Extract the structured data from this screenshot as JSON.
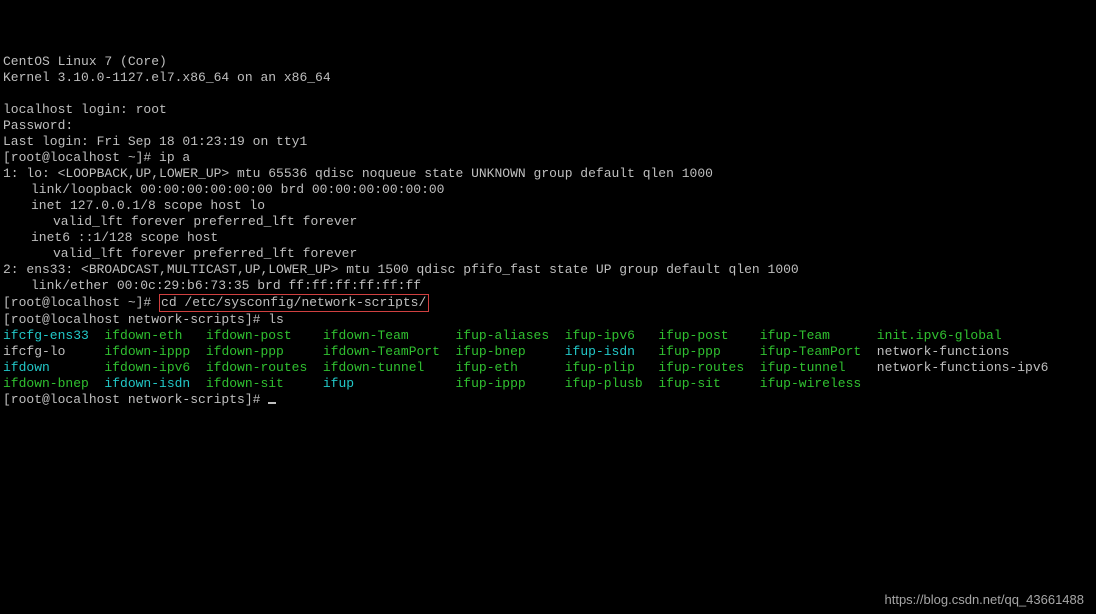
{
  "banner": {
    "l1": "CentOS Linux 7 (Core)",
    "l2": "Kernel 3.10.0-1127.el7.x86_64 on an x86_64"
  },
  "login": {
    "prompt": "localhost login: root",
    "password": "Password:",
    "last": "Last login: Fri Sep 18 01:23:19 on tty1"
  },
  "prompt1": {
    "full": "[root@localhost ~]# ip a"
  },
  "ip": {
    "lo1": "1: lo: <LOOPBACK,UP,LOWER_UP> mtu 65536 qdisc noqueue state UNKNOWN group default qlen 1000",
    "lo_link": "link/loopback 00:00:00:00:00:00 brd 00:00:00:00:00:00",
    "lo_inet": "inet 127.0.0.1/8 scope host lo",
    "lo_valid": "valid_lft forever preferred_lft forever",
    "lo_inet6": "inet6 ::1/128 scope host",
    "lo_valid2": "valid_lft forever preferred_lft forever",
    "ens1": "2: ens33: <BROADCAST,MULTICAST,UP,LOWER_UP> mtu 1500 qdisc pfifo_fast state UP group default qlen 1000",
    "ens_link": "link/ether 00:0c:29:b6:73:35 brd ff:ff:ff:ff:ff:ff"
  },
  "cd": {
    "prompt_prefix": "[root@localhost ~]# ",
    "cmd": "cd /etc/sysconfig/network-scripts/"
  },
  "prompt_ls": "[root@localhost network-scripts]# ls",
  "ls": {
    "row1": {
      "c1": "ifcfg-ens33",
      "c2": "ifdown-eth",
      "c3": "ifdown-post",
      "c4": "ifdown-Team",
      "c5": "ifup-aliases",
      "c6": "ifup-ipv6",
      "c7": "ifup-post",
      "c8": "ifup-Team",
      "c9": "init.ipv6-global"
    },
    "row2": {
      "c1": "ifcfg-lo",
      "c2": "ifdown-ippp",
      "c3": "ifdown-ppp",
      "c4": "ifdown-TeamPort",
      "c5": "ifup-bnep",
      "c6": "ifup-isdn",
      "c7": "ifup-ppp",
      "c8": "ifup-TeamPort",
      "c9": "network-functions"
    },
    "row3": {
      "c1": "ifdown",
      "c2": "ifdown-ipv6",
      "c3": "ifdown-routes",
      "c4": "ifdown-tunnel",
      "c5": "ifup-eth",
      "c6": "ifup-plip",
      "c7": "ifup-routes",
      "c8": "ifup-tunnel",
      "c9": "network-functions-ipv6"
    },
    "row4": {
      "c1": "ifdown-bnep",
      "c2": "ifdown-isdn",
      "c3": "ifdown-sit",
      "c4": "ifup",
      "c5": "ifup-ippp",
      "c6": "ifup-plusb",
      "c7": "ifup-sit",
      "c8": "ifup-wireless"
    }
  },
  "prompt_final": "[root@localhost network-scripts]# ",
  "watermark": "https://blog.csdn.net/qq_43661488"
}
